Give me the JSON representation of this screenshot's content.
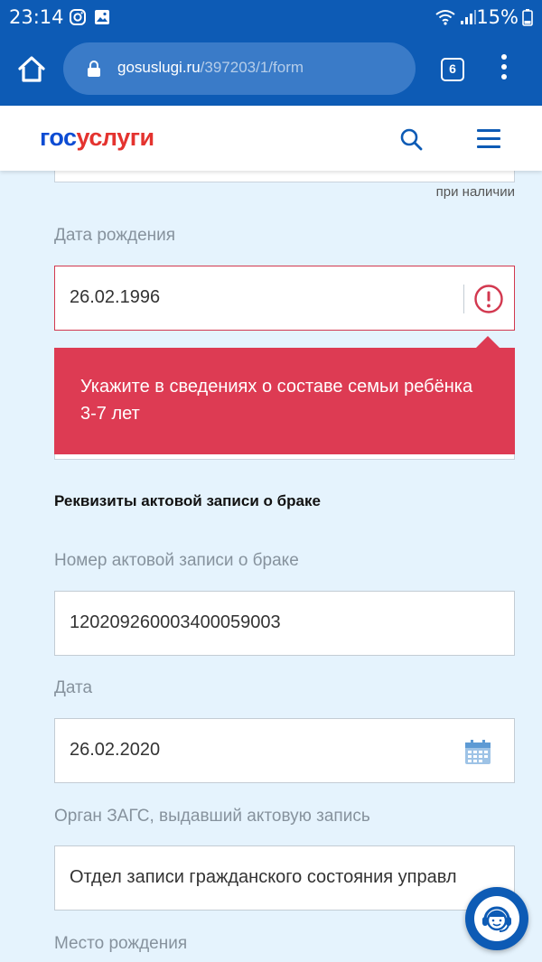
{
  "status_bar": {
    "time": "23:14",
    "battery": "15%"
  },
  "browser": {
    "url_domain": "gosuslugi.ru",
    "url_path": "/397203/1/form",
    "tab_count": "6"
  },
  "site": {
    "logo_part1": "гос",
    "logo_part2": "услуги"
  },
  "form": {
    "prev_field_hint": "при наличии",
    "birth_date": {
      "label": "Дата рождения",
      "value": "26.02.1996"
    },
    "error_message": "Укажите в сведениях о составе семьи ребёнка 3-7 лет",
    "section_title": "Реквизиты актовой записи о браке",
    "marriage_record_number": {
      "label": "Номер актовой записи о браке",
      "value": "120209260003400059003"
    },
    "date": {
      "label": "Дата",
      "value": "26.02.2020"
    },
    "registry_office": {
      "label": "Орган ЗАГС, выдавший актовую запись",
      "value": "Отдел записи гражданского состояния управл"
    },
    "birth_place": {
      "label": "Место рождения"
    }
  },
  "colors": {
    "brand_blue": "#0d5bb5",
    "error_red": "#dd3b53",
    "logo_blue": "#0d4cd3",
    "logo_red": "#e4332f"
  }
}
